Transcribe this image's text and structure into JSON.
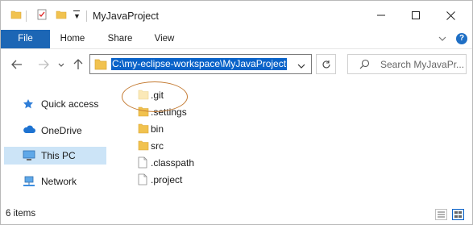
{
  "window": {
    "title": "MyJavaProject"
  },
  "ribbon": {
    "tabs": [
      "File",
      "Home",
      "Share",
      "View"
    ],
    "help_label": "?"
  },
  "address": {
    "path": "C:\\my-eclipse-workspace\\MyJavaProject"
  },
  "search": {
    "placeholder": "Search MyJavaPr..."
  },
  "sidebar": {
    "items": [
      {
        "label": "Quick access",
        "icon": "star-icon"
      },
      {
        "label": "OneDrive",
        "icon": "cloud-icon"
      },
      {
        "label": "This PC",
        "icon": "computer-icon",
        "selected": true
      },
      {
        "label": "Network",
        "icon": "network-icon"
      }
    ]
  },
  "files": {
    "items": [
      {
        "name": ".git",
        "type": "folder",
        "faded": true
      },
      {
        "name": ".settings",
        "type": "folder"
      },
      {
        "name": "bin",
        "type": "folder"
      },
      {
        "name": "src",
        "type": "folder"
      },
      {
        "name": ".classpath",
        "type": "file"
      },
      {
        "name": ".project",
        "type": "file"
      }
    ]
  },
  "status": {
    "count": "6 items"
  },
  "colors": {
    "accent": "#1c66b5",
    "selection": "#0a63c9",
    "sidebar_selected": "#cce4f7",
    "folder": "#f1c24f",
    "highlight_oval": "#c47b33"
  }
}
